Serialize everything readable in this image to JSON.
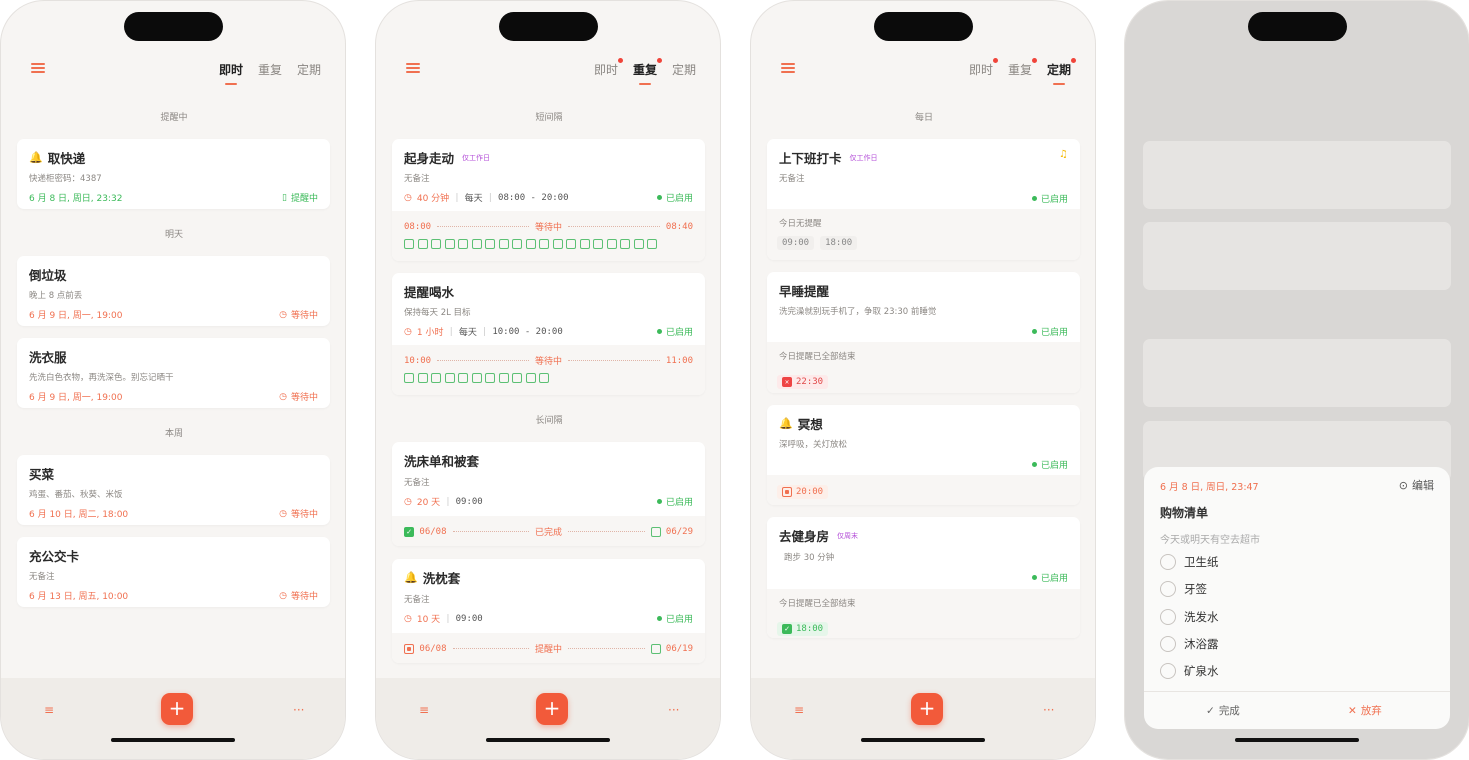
{
  "tabs": [
    "即时",
    "重复",
    "定期"
  ],
  "screen1": {
    "sections": [
      "提醒中",
      "明天",
      "本周"
    ],
    "cards": [
      {
        "title": "取快递",
        "note": "快递柜密码：4387",
        "date": "6 月 8 日, 周日, 23:32",
        "status": "提醒中"
      },
      {
        "title": "倒垃圾",
        "note": "晚上 8 点前丢",
        "date": "6 月 9 日, 周一, 19:00",
        "status": "等待中"
      },
      {
        "title": "洗衣服",
        "note": "先洗白色衣物，再洗深色。别忘记晒干",
        "date": "6 月 9 日, 周一, 19:00",
        "status": "等待中"
      },
      {
        "title": "买菜",
        "note": "鸡蛋、番茄、秋葵、米饭",
        "date": "6 月 10 日, 周二, 18:00",
        "status": "等待中"
      },
      {
        "title": "充公交卡",
        "note": "无备注",
        "date": "6 月 13 日, 周五, 10:00",
        "status": "等待中"
      }
    ]
  },
  "screen2": {
    "sections": [
      "短间隔",
      "长间隔"
    ],
    "cards": [
      {
        "title": "起身走动",
        "tag": "仅工作日",
        "note": "无备注",
        "interval": "40 分钟",
        "freq": "每天",
        "range": "08:00 - 20:00",
        "status": "已启用",
        "tl_start": "08:00",
        "tl_mid": "等待中",
        "tl_end": "08:40"
      },
      {
        "title": "提醒喝水",
        "note": "保持每天 2L 目标",
        "interval": "1 小时",
        "freq": "每天",
        "range": "10:00 - 20:00",
        "status": "已启用",
        "tl_start": "10:00",
        "tl_mid": "等待中",
        "tl_end": "11:00"
      },
      {
        "title": "洗床单和被套",
        "note": "无备注",
        "interval": "20 天",
        "time": "09:00",
        "status": "已启用",
        "tl_start": "06/08",
        "tl_mid": "已完成",
        "tl_end": "06/29"
      },
      {
        "title": "洗枕套",
        "note": "无备注",
        "interval": "10 天",
        "time": "09:00",
        "status": "已启用",
        "tl_start": "06/08",
        "tl_mid": "提醒中",
        "tl_end": "06/19"
      }
    ]
  },
  "screen3": {
    "section": "每日",
    "cards": [
      {
        "title": "上下班打卡",
        "tag": "仅工作日",
        "note": "无备注",
        "status": "已启用",
        "today": "今日无提醒",
        "chips": [
          "09:00",
          "18:00"
        ]
      },
      {
        "title": "早睡提醒",
        "note": "洗完澡就别玩手机了，争取 23:30 前睡觉",
        "status": "已启用",
        "today": "今日提醒已全部结束",
        "chips": [
          "22:30"
        ]
      },
      {
        "title": "冥想",
        "note": "深呼吸，关灯放松",
        "status": "已启用",
        "chips": [
          "20:00"
        ]
      },
      {
        "title": "去健身房",
        "tag": "仅周末",
        "note": "跑步 30 分钟",
        "status": "已启用",
        "today": "今日提醒已全部结束",
        "chips": [
          "18:00"
        ]
      }
    ]
  },
  "sheet": {
    "date": "6 月 8 日, 周日, 23:47",
    "edit": "编辑",
    "title": "购物清单",
    "note": "今天或明天有空去超市",
    "items": [
      "卫生纸",
      "牙签",
      "洗发水",
      "沐浴露",
      "矿泉水"
    ],
    "done": "完成",
    "discard": "放弃"
  },
  "colors": {
    "accent": "#f07050",
    "green": "#3cba5a",
    "purple": "#b44fd8"
  }
}
